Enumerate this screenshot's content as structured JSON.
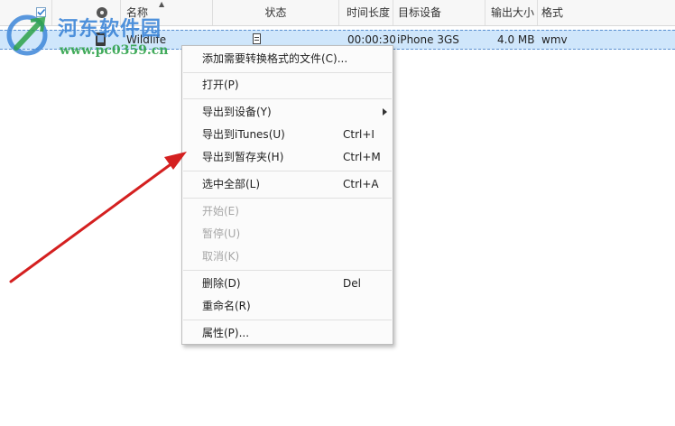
{
  "table": {
    "columns": {
      "name": "名称",
      "status": "状态",
      "duration": "时间长度",
      "target_device": "目标设备",
      "output_size": "输出大小",
      "format": "格式"
    },
    "rows": [
      {
        "name": "Wildlife",
        "duration": "00:00:30",
        "target_device": "iPhone 3GS",
        "output_size": "4.0 MB",
        "format": "wmv",
        "checked": true
      }
    ]
  },
  "watermark": {
    "title": "河东软件园",
    "url": "www.pc0359.cn"
  },
  "context_menu": {
    "items": [
      {
        "label": "添加需要转换格式的文件(C)...",
        "shortcut": "",
        "enabled": true
      },
      {
        "label": "打开(P)",
        "shortcut": "",
        "enabled": true
      },
      {
        "label": "导出到设备(Y)",
        "shortcut": "",
        "enabled": true,
        "submenu": true
      },
      {
        "label": "导出到iTunes(U)",
        "shortcut": "Ctrl+I",
        "enabled": true
      },
      {
        "label": "导出到暂存夹(H)",
        "shortcut": "Ctrl+M",
        "enabled": true
      },
      {
        "label": "选中全部(L)",
        "shortcut": "Ctrl+A",
        "enabled": true
      },
      {
        "label": "开始(E)",
        "shortcut": "",
        "enabled": false
      },
      {
        "label": "暂停(U)",
        "shortcut": "",
        "enabled": false
      },
      {
        "label": "取消(K)",
        "shortcut": "",
        "enabled": false
      },
      {
        "label": "删除(D)",
        "shortcut": "Del",
        "enabled": true
      },
      {
        "label": "重命名(R)",
        "shortcut": "",
        "enabled": true
      },
      {
        "label": "属性(P)...",
        "shortcut": "",
        "enabled": true
      }
    ]
  },
  "colors": {
    "selection": "#cfe6fb",
    "annotation_arrow": "#d42020",
    "watermark_blue": "#3d86d8",
    "watermark_green": "#2ea24a"
  }
}
